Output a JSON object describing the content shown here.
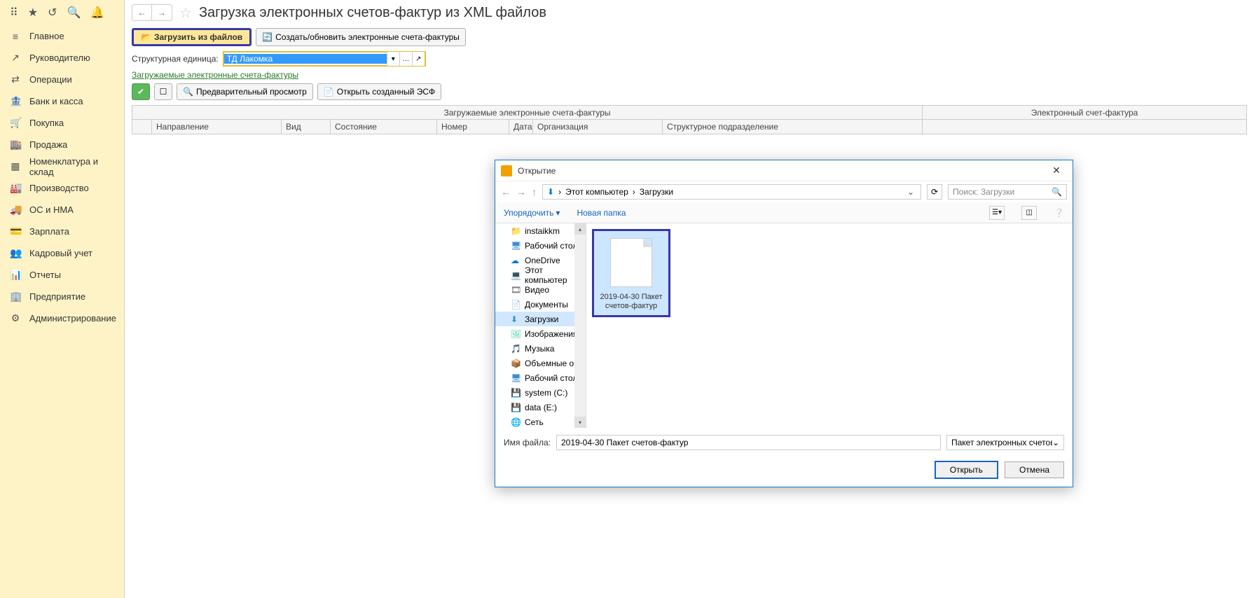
{
  "sidebar": {
    "items": [
      {
        "icon": "≡",
        "label": "Главное"
      },
      {
        "icon": "↗",
        "label": "Руководителю"
      },
      {
        "icon": "⇄",
        "label": "Операции"
      },
      {
        "icon": "🏦",
        "label": "Банк и касса"
      },
      {
        "icon": "🛒",
        "label": "Покупка"
      },
      {
        "icon": "🏬",
        "label": "Продажа"
      },
      {
        "icon": "▦",
        "label": "Номенклатура и склад"
      },
      {
        "icon": "🏭",
        "label": "Производство"
      },
      {
        "icon": "🚚",
        "label": "ОС и НМА"
      },
      {
        "icon": "💳",
        "label": "Зарплата"
      },
      {
        "icon": "👥",
        "label": "Кадровый учет"
      },
      {
        "icon": "📊",
        "label": "Отчеты"
      },
      {
        "icon": "🏢",
        "label": "Предприятие"
      },
      {
        "icon": "⚙",
        "label": "Администрирование"
      }
    ]
  },
  "page": {
    "title": "Загрузка электронных счетов-фактур из XML файлов"
  },
  "toolbar": {
    "load_btn": "Загрузить из файлов",
    "create_btn": "Создать/обновить электронные счета-фактуры"
  },
  "field": {
    "label": "Структурная единица:",
    "value": "ТД Лакомка"
  },
  "section": {
    "label": "Загружаемые электронные счета-фактуры"
  },
  "toolbar2": {
    "preview": "Предварительный просмотр",
    "open_esf": "Открыть созданный ЭСФ"
  },
  "table": {
    "super1": "Загружаемые электронные счета-фактуры",
    "super2": "Электронный счет-фактура",
    "cols": [
      "Направление",
      "Вид",
      "Состояние",
      "Номер",
      "Дата",
      "Организация",
      "Структурное подразделение"
    ]
  },
  "dialog": {
    "title": "Открытие",
    "breadcrumb": [
      "Этот компьютер",
      "Загрузки"
    ],
    "search_placeholder": "Поиск: Загрузки",
    "tool_sort": "Упорядочить",
    "tool_newfolder": "Новая папка",
    "tree": [
      {
        "icon": "📁",
        "label": "instaikkm",
        "color": "#f0c040"
      },
      {
        "icon": "🖥",
        "label": "Рабочий стол",
        "color": "#3b8bd0"
      },
      {
        "icon": "☁",
        "label": "OneDrive",
        "color": "#0078d4"
      },
      {
        "icon": "💻",
        "label": "Этот компьютер",
        "color": "#3b8bd0"
      },
      {
        "icon": "🎞",
        "label": "Видео",
        "color": "#666"
      },
      {
        "icon": "📄",
        "label": "Документы",
        "color": "#666"
      },
      {
        "icon": "⬇",
        "label": "Загрузки",
        "color": "#3b8bd0",
        "sel": true
      },
      {
        "icon": "🖼",
        "label": "Изображения",
        "color": "#3bd0a0"
      },
      {
        "icon": "🎵",
        "label": "Музыка",
        "color": "#3b8bd0"
      },
      {
        "icon": "📦",
        "label": "Объемные объ",
        "color": "#3bd0d0"
      },
      {
        "icon": "🖥",
        "label": "Рабочий стол",
        "color": "#3b8bd0"
      },
      {
        "icon": "💾",
        "label": "system (C:)",
        "color": "#999"
      },
      {
        "icon": "💾",
        "label": "data (E:)",
        "color": "#999"
      },
      {
        "icon": "🌐",
        "label": "Сеть",
        "color": "#3b8bd0"
      }
    ],
    "file": {
      "name": "2019-04-30 Пакет счетов-фактур"
    },
    "fn_label": "Имя файла:",
    "fn_value": "2019-04-30 Пакет счетов-фактур",
    "filter": "Пакет электронных счетов-фа",
    "open": "Открыть",
    "cancel": "Отмена"
  }
}
